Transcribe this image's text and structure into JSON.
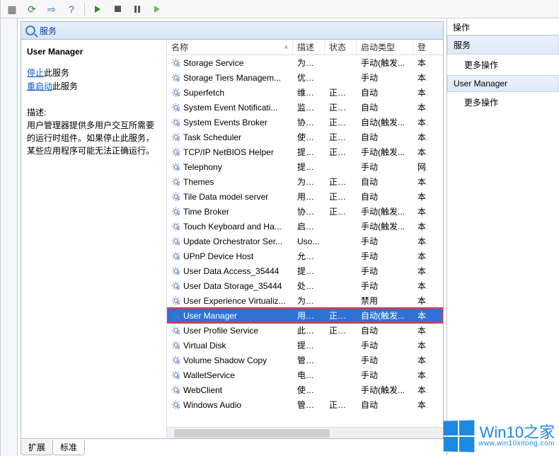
{
  "toolbar": {
    "icons": [
      "grid-icon",
      "refresh-icon",
      "export-icon",
      "help-icon",
      "play-icon",
      "stop-icon",
      "pause-icon",
      "restart-icon"
    ]
  },
  "pane": {
    "title": "服务",
    "selected_service": "User Manager",
    "action_links": {
      "stop_prefix": "停止",
      "stop_rest": "此服务",
      "restart_prefix": "重启动",
      "restart_rest": "此服务"
    },
    "desc_label": "描述:",
    "desc_text": "用户管理器提供多用户交互所需要的运行时组件。如果停止此服务，某些应用程序可能无法正确运行。"
  },
  "columns": {
    "name": "名称",
    "desc": "描述",
    "status": "状态",
    "startup": "启动类型",
    "logon": "登"
  },
  "rows": [
    {
      "name": "Storage Service",
      "desc": "为存...",
      "status": "",
      "startup": "手动(触发...",
      "last": "本"
    },
    {
      "name": "Storage Tiers Managem...",
      "desc": "优化...",
      "status": "",
      "startup": "手动",
      "last": "本"
    },
    {
      "name": "Superfetch",
      "desc": "维护...",
      "status": "正在...",
      "startup": "自动",
      "last": "本"
    },
    {
      "name": "System Event Notificati...",
      "desc": "监视...",
      "status": "正在...",
      "startup": "自动",
      "last": "本"
    },
    {
      "name": "System Events Broker",
      "desc": "协调...",
      "status": "正在...",
      "startup": "自动(触发...",
      "last": "本"
    },
    {
      "name": "Task Scheduler",
      "desc": "使用...",
      "status": "正在...",
      "startup": "自动",
      "last": "本"
    },
    {
      "name": "TCP/IP NetBIOS Helper",
      "desc": "提供...",
      "status": "正在...",
      "startup": "手动(触发...",
      "last": "本"
    },
    {
      "name": "Telephony",
      "desc": "提供...",
      "status": "",
      "startup": "手动",
      "last": "网"
    },
    {
      "name": "Themes",
      "desc": "为用...",
      "status": "正在...",
      "startup": "自动",
      "last": "本"
    },
    {
      "name": "Tile Data model server",
      "desc": "用于...",
      "status": "正在...",
      "startup": "自动",
      "last": "本"
    },
    {
      "name": "Time Broker",
      "desc": "协调...",
      "status": "正在...",
      "startup": "手动(触发...",
      "last": "本"
    },
    {
      "name": "Touch Keyboard and Ha...",
      "desc": "启用...",
      "status": "",
      "startup": "手动(触发...",
      "last": "本"
    },
    {
      "name": "Update Orchestrator Ser...",
      "desc": "Uso...",
      "status": "",
      "startup": "手动",
      "last": "本"
    },
    {
      "name": "UPnP Device Host",
      "desc": "允许...",
      "status": "",
      "startup": "手动",
      "last": "本"
    },
    {
      "name": "User Data Access_35444",
      "desc": "提供...",
      "status": "",
      "startup": "手动",
      "last": "本"
    },
    {
      "name": "User Data Storage_35444",
      "desc": "处理...",
      "status": "",
      "startup": "手动",
      "last": "本"
    },
    {
      "name": "User Experience Virtualiz...",
      "desc": "为应...",
      "status": "",
      "startup": "禁用",
      "last": "本"
    },
    {
      "name": "User Manager",
      "desc": "用户...",
      "status": "正在...",
      "startup": "自动(触发...",
      "last": "本",
      "selected": true
    },
    {
      "name": "User Profile Service",
      "desc": "此服...",
      "status": "正在...",
      "startup": "自动",
      "last": "本"
    },
    {
      "name": "Virtual Disk",
      "desc": "提供...",
      "status": "",
      "startup": "手动",
      "last": "本"
    },
    {
      "name": "Volume Shadow Copy",
      "desc": "管理...",
      "status": "",
      "startup": "手动",
      "last": "本"
    },
    {
      "name": "WalletService",
      "desc": "电子...",
      "status": "",
      "startup": "手动",
      "last": "本"
    },
    {
      "name": "WebClient",
      "desc": "使基...",
      "status": "",
      "startup": "手动(触发...",
      "last": "本"
    },
    {
      "name": "Windows Audio",
      "desc": "管理...",
      "status": "正在...",
      "startup": "自动",
      "last": "本"
    }
  ],
  "tabs": {
    "extended": "扩展",
    "standard": "标准"
  },
  "right": {
    "header": "操作",
    "section1": "服务",
    "item1": "更多操作",
    "section2": "User Manager",
    "item2": "更多操作"
  },
  "watermark": {
    "brand1": "Win10",
    "brand2": "之家",
    "url": "www.win10xitong.com"
  }
}
